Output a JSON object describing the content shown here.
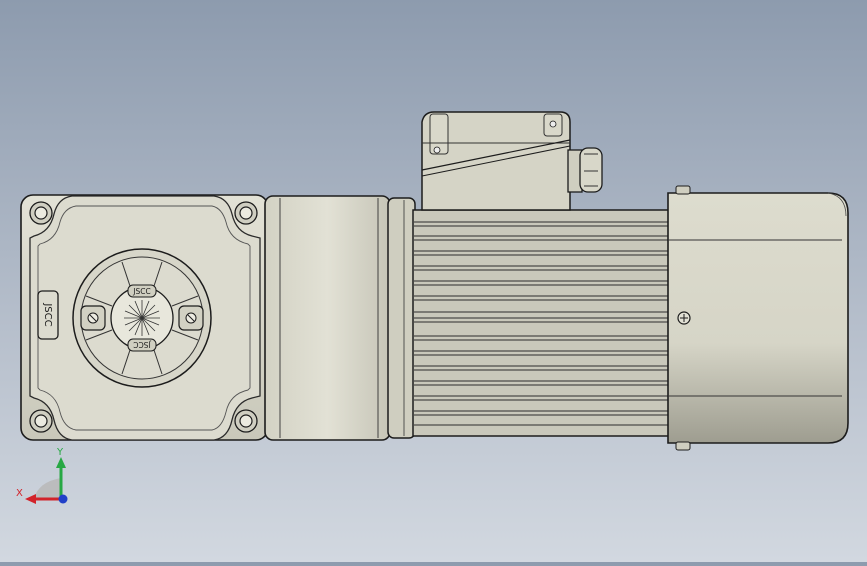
{
  "viewport": {
    "background_top": "#8d9bae",
    "background_bottom": "#d2d8e0"
  },
  "model": {
    "body_color": "#d9d8cb",
    "body_shadow": "#b7b6a8",
    "outline_color": "#1c1c1c",
    "nameplate_text": "JSCC",
    "bolt_label_text": "JSCC"
  },
  "triad": {
    "x_label": "X",
    "y_label": "Y",
    "x_color": "#d2232a",
    "y_color": "#27a844",
    "z_color": "#2140c8"
  }
}
